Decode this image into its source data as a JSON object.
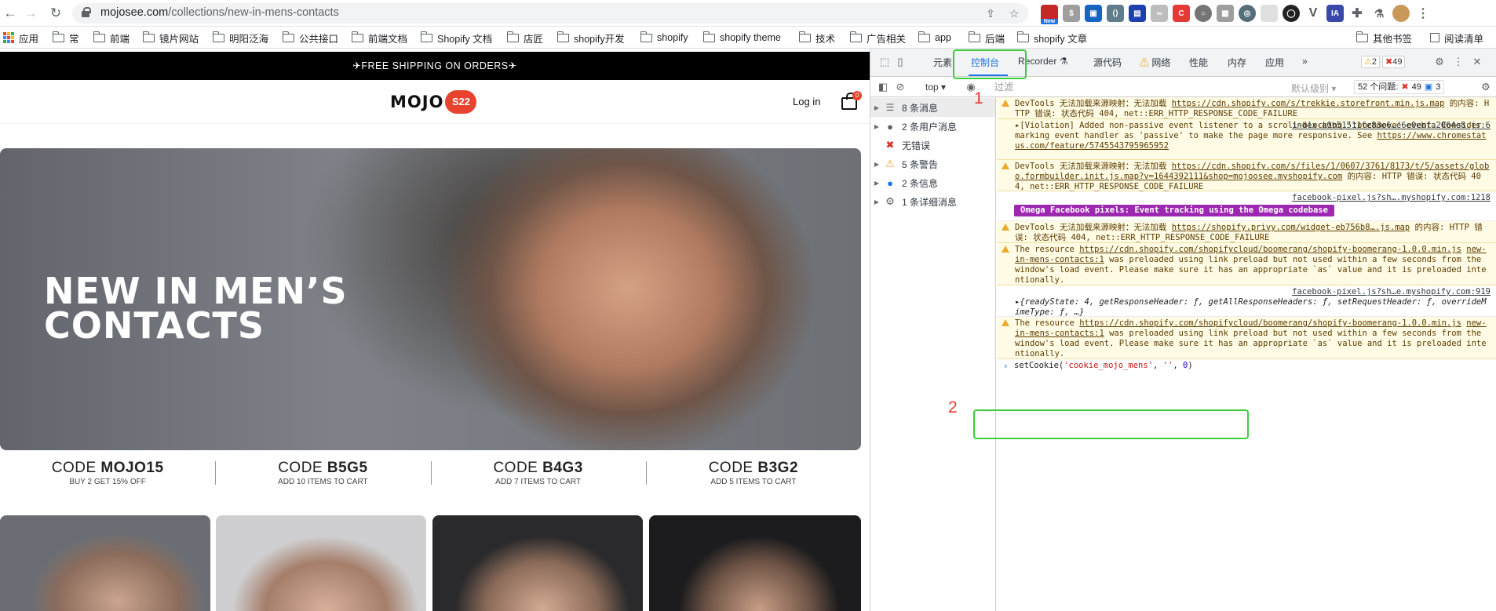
{
  "browser": {
    "url_domain": "mojosee.com",
    "url_path": "/collections/new-in-mens-contacts",
    "new_badge": "New"
  },
  "bookmarks": [
    "应用",
    "常",
    "前端",
    "镜片网站",
    "明阳泛海",
    "公共接口",
    "前端文档",
    "Shopify 文档",
    "店匠",
    "shopify开发",
    "shopify",
    "shopify theme",
    "技术",
    "广告相关",
    "app",
    "后端",
    "shopify 文章",
    "其他书签",
    "阅读清单"
  ],
  "site": {
    "promo": "✈FREE SHIPPING ON ORDERS✈",
    "logo_text": "MOJO",
    "logo_badge": "S22",
    "login": "Log in",
    "cart_count": "0",
    "hero_title_line1": "NEW IN MEN’S",
    "hero_title_line2": "CONTACTS",
    "codes": [
      {
        "prefix": "CODE ",
        "code": "MOJO15",
        "sub": "BUY 2 GET 15% OFF"
      },
      {
        "prefix": "CODE ",
        "code": "B5G5",
        "sub": "ADD 10 ITEMS TO CART"
      },
      {
        "prefix": "CODE ",
        "code": "B4G3",
        "sub": "ADD 7 ITEMS TO CART"
      },
      {
        "prefix": "CODE ",
        "code": "B3G2",
        "sub": "ADD 5 ITEMS TO CART"
      }
    ]
  },
  "devtools": {
    "tabs": [
      "元素",
      "控制台",
      "Recorder",
      "源代码",
      "网络",
      "性能",
      "内存",
      "应用",
      "»"
    ],
    "warn_count": "2",
    "error_count": "49",
    "context": "top",
    "filter_placeholder": "过滤",
    "level": "默认级别",
    "issues_label": "52 个问题:",
    "issues_errors": "49",
    "issues_info": "3",
    "sidebar": [
      {
        "label": "8 条消息",
        "icon": "list-icon",
        "color": "#5f6368"
      },
      {
        "label": "2 条用户消息",
        "icon": "user-icon",
        "color": "#5f6368"
      },
      {
        "label": "无错误",
        "icon": "error-icon",
        "color": "#d93025"
      },
      {
        "label": "5 条警告",
        "icon": "warning-icon",
        "color": "#f0a92a"
      },
      {
        "label": "2 条信息",
        "icon": "info-icon",
        "color": "#1a73e8"
      },
      {
        "label": "1 条详细消息",
        "icon": "gear-icon",
        "color": "#5f6368"
      }
    ],
    "messages": {
      "m1_text": "DevTools 无法加载来源映射：无法加载 ",
      "m1_link": "https://cdn.shopify.com/s/trekkie.storefront.min.js.map",
      "m1_tail": " 的内容: HTTP 错误: 状态代码 404, net::ERR_HTTP_RESPONSE_CODE_FAILURE",
      "m2_src": "index-a0b51511fe83e6…e6e0ebfa2064e8.js:6",
      "m2_text": "▸[Violation] Added non-passive event listener to a scroll-blocking 'touchmove' event. Consider marking event handler as 'passive' to make the page more responsive. See ",
      "m2_link": "https://www.chromestatus.com/feature/5745543795965952",
      "m3_text": "DevTools 无法加载来源映射：无法加载 ",
      "m3_link": "https://cdn.shopify.com/s/files/1/0607/3761/8173/t/5/assets/globo.formbuilder.init.js.map?v=1644392111&shop=mojoosee.myshopify.com",
      "m3_tail": " 的内容: HTTP 错误: 状态代码 404, net::ERR_HTTP_RESPONSE_CODE_FAILURE",
      "m4_src": "facebook-pixel.js?sh….myshopify.com:1218",
      "m4_badge": "Omega Facebook pixels: Event tracking using the Omega codebase",
      "m5_text": "DevTools 无法加载来源映射：无法加载 ",
      "m5_link": "https://shopify.privy.com/widget-eb756b8….js.map",
      "m5_tail": " 的内容: HTTP 错误: 状态代码 404, net::ERR_HTTP_RESPONSE_CODE_FAILURE",
      "m6_text": "The resource ",
      "m6_link": "https://cdn.shopify.com/shopifycloud/boomerang/shopify-boomerang-1.0.0.min.js",
      "m6_src": "new-in-mens-contacts:1",
      "m6_tail": " was preloaded using link preload but not used within a few seconds from the window's load event. Please make sure it has an appropriate `as` value and it is preloaded intentionally.",
      "m7_src": "facebook-pixel.js?sh…e.myshopify.com:919",
      "m7_text": "▸{readyState: 4, getResponseHeader: ƒ, getAllResponseHeaders: ƒ, setRequestHeader: ƒ, overrideMimeType: ƒ, …}",
      "m8_text": "The resource ",
      "m8_link": "https://cdn.shopify.com/shopifycloud/boomerang/shopify-boomerang-1.0.0.min.js",
      "m8_src": "new-in-mens-contacts:1",
      "m8_tail": " was preloaded using link preload but not used within a few seconds from the window's load event. Please make sure it has an appropriate `as` value and it is preloaded intentionally."
    },
    "prompt_fn": "setCookie(",
    "prompt_arg1": "'cookie_mojo_mens'",
    "prompt_sep1": ", ",
    "prompt_arg2": "''",
    "prompt_sep2": ", ",
    "prompt_arg3": "0",
    "prompt_close": ")"
  },
  "annotations": {
    "label1": "1",
    "label2": "2",
    "box_color": "#3ccf3c",
    "label_color": "#e53935"
  }
}
